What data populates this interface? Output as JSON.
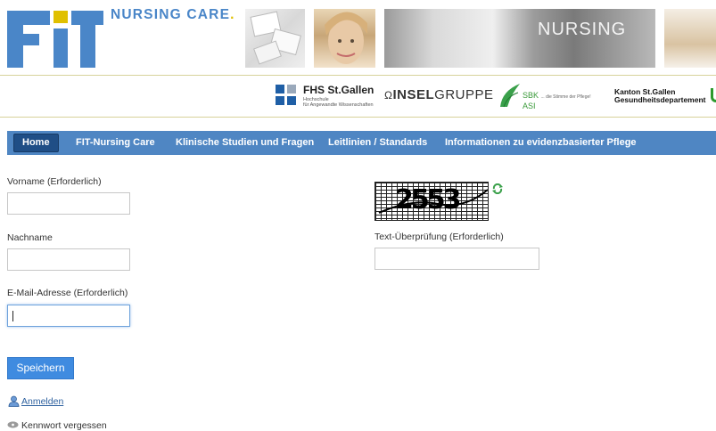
{
  "header": {
    "logo_letters": "FIT",
    "tagline": "NURSING CARE",
    "tagline_dot": ".",
    "journal_title": "NURSING"
  },
  "partners": {
    "fhs_name": "FHS St.Gallen",
    "fhs_sub_line1": "Hochschule",
    "fhs_sub_line2": "für Angewandte Wissenschaften",
    "insel_bold": "INSEL",
    "insel_rest": "GRUPPE",
    "sbk_name": "SBK",
    "sbk_sub": "ASI",
    "sbk_slogan": "... die Stimme der Pflege!",
    "kanton_line1": "Kanton St.Gallen",
    "kanton_line2": "Gesundheitsdepartement"
  },
  "nav": {
    "items": [
      {
        "label": "Home",
        "active": true
      },
      {
        "label": "FIT-Nursing Care"
      },
      {
        "label": "Klinische Studien und Fragen"
      },
      {
        "label": "Leitlinien / Standards"
      },
      {
        "label": "Informationen zu evidenzbasierter Pflege"
      }
    ]
  },
  "form": {
    "vorname_label": "Vorname (Erforderlich)",
    "vorname_value": "",
    "nachname_label": "Nachname",
    "nachname_value": "",
    "email_label": "E-Mail-Adresse (Erforderlich)",
    "email_value": "",
    "captcha_text": "2553",
    "text_check_label": "Text-Überprüfung (Erforderlich)",
    "text_check_value": "",
    "save_label": "Speichern"
  },
  "links": {
    "login": "Anmelden",
    "forgot": "Kennwort vergessen"
  },
  "colors": {
    "brand_blue": "#4a86c8",
    "nav_bg": "#4f86c3",
    "nav_active": "#1f4e86",
    "button": "#3f8be0",
    "accent_yellow": "#e0c000"
  }
}
